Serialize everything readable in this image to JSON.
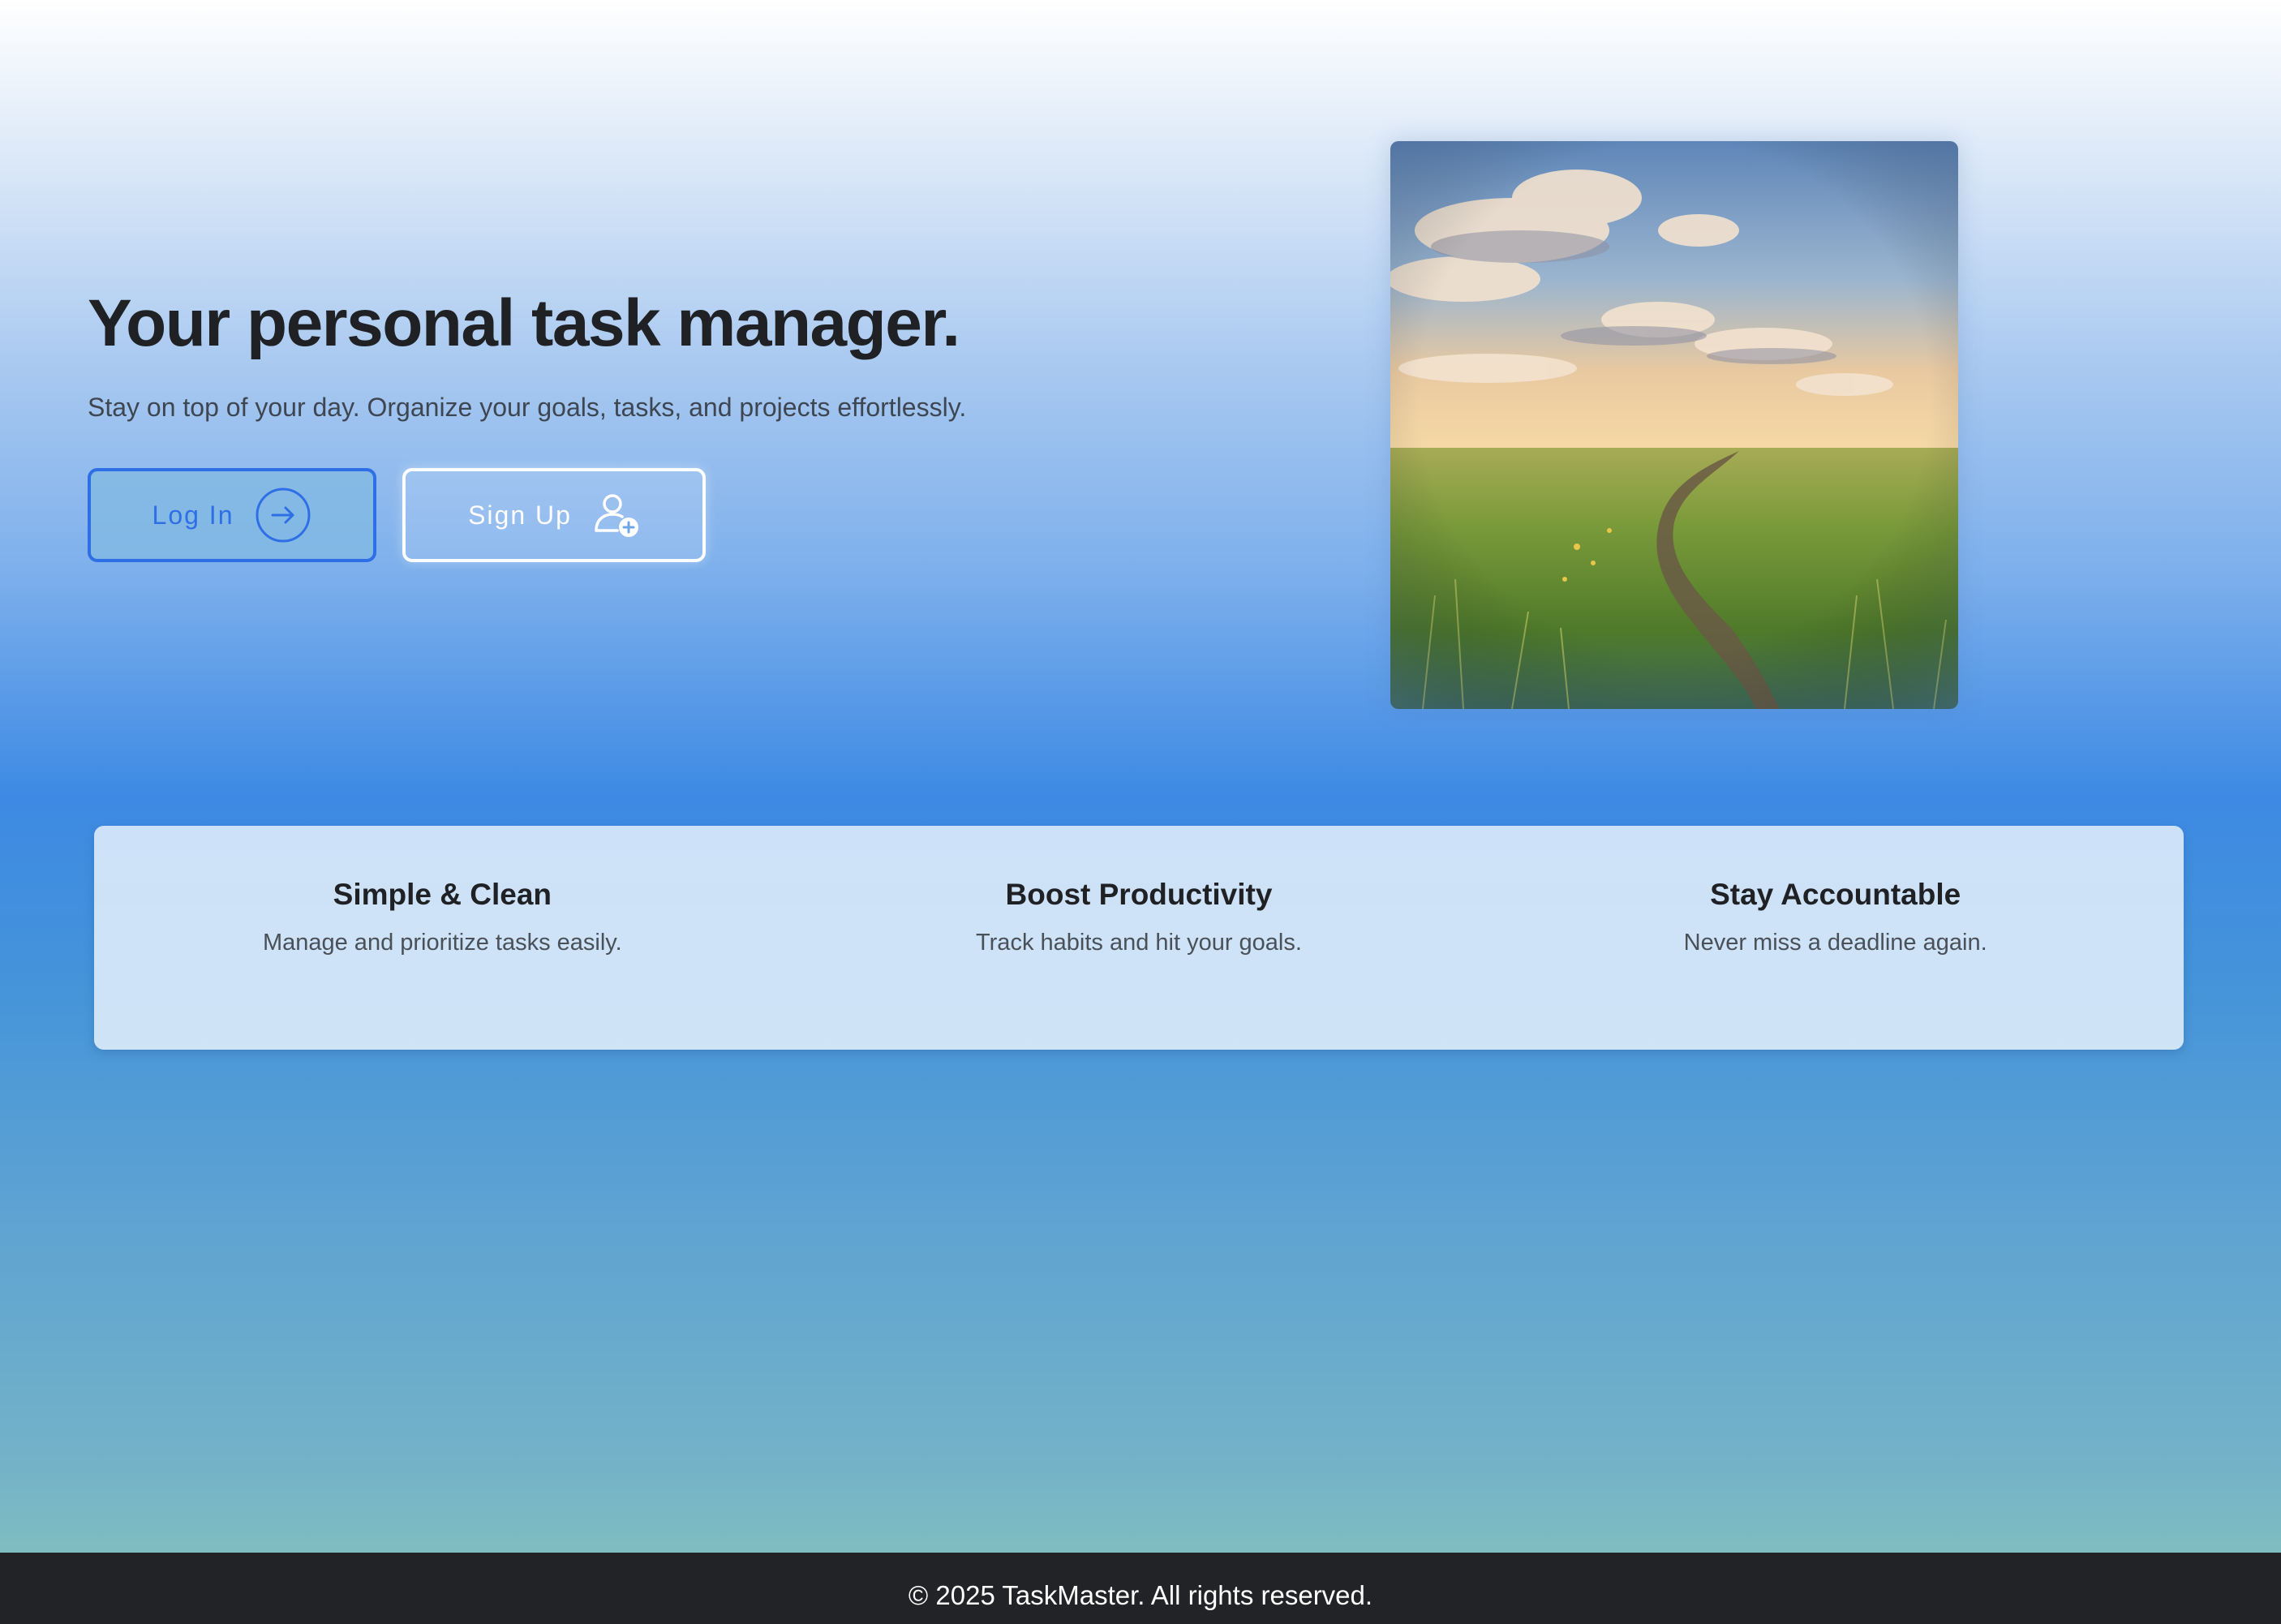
{
  "hero": {
    "title": "Your personal task manager.",
    "subtitle": "Stay on top of your day. Organize your goals, tasks, and projects effortlessly."
  },
  "buttons": {
    "login_label": "Log In",
    "login_icon": "arrow-right-circle-icon",
    "signup_label": "Sign Up",
    "signup_icon": "user-plus-icon"
  },
  "image": {
    "subject": "meadow-path-landscape"
  },
  "features": [
    {
      "title": "Simple & Clean",
      "description": "Manage and prioritize tasks easily."
    },
    {
      "title": "Boost Productivity",
      "description": "Track habits and hit your goals."
    },
    {
      "title": "Stay Accountable",
      "description": "Never miss a deadline again."
    }
  ],
  "footer": {
    "text": "© 2025 TaskMaster. All rights reserved."
  },
  "colors": {
    "accent": "#2f6fe6",
    "footer_bg": "#212326",
    "title_text": "#1f2125"
  }
}
